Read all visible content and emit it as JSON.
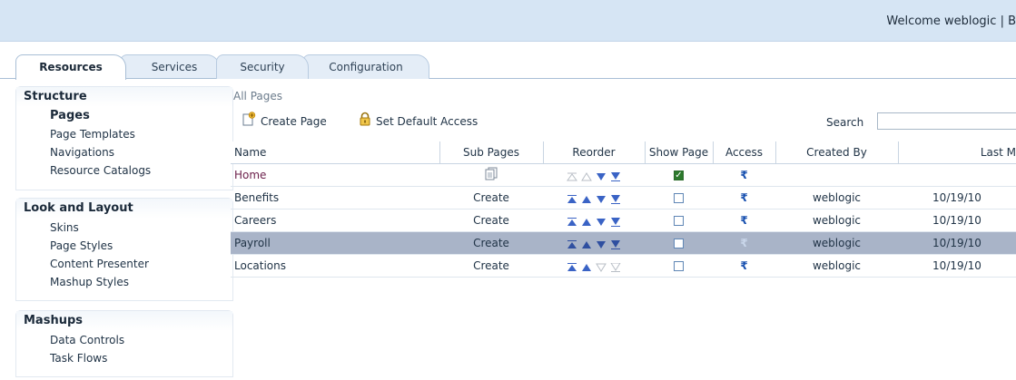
{
  "header": {
    "welcome": "Welcome weblogic  |  B"
  },
  "tabs": [
    {
      "label": "Resources"
    },
    {
      "label": "Services"
    },
    {
      "label": "Security"
    },
    {
      "label": "Configuration"
    }
  ],
  "sidebar": {
    "sections": [
      {
        "title": "Structure",
        "items": [
          {
            "label": "Pages"
          },
          {
            "label": "Page Templates"
          },
          {
            "label": "Navigations"
          },
          {
            "label": "Resource Catalogs"
          }
        ]
      },
      {
        "title": "Look and Layout",
        "items": [
          {
            "label": "Skins"
          },
          {
            "label": "Page Styles"
          },
          {
            "label": "Content Presenter"
          },
          {
            "label": "Mashup Styles"
          }
        ]
      },
      {
        "title": "Mashups",
        "items": [
          {
            "label": "Data Controls"
          },
          {
            "label": "Task Flows"
          }
        ]
      }
    ]
  },
  "main": {
    "breadcrumb": "All Pages",
    "toolbar": {
      "create_page": "Create Page",
      "set_default_access": "Set Default Access"
    },
    "search": {
      "label": "Search",
      "value": ""
    },
    "table": {
      "columns": [
        "Name",
        "Sub Pages",
        "Reorder",
        "Show Page",
        "Access",
        "Created By",
        "Last M"
      ],
      "rows": [
        {
          "name": "Home",
          "sub_pages": "",
          "show_page": true,
          "access": "₹",
          "created_by": "",
          "last_modified": ""
        },
        {
          "name": "Benefits",
          "sub_pages": "Create",
          "show_page": false,
          "access": "₹",
          "created_by": "weblogic",
          "last_modified": "10/19/10"
        },
        {
          "name": "Careers",
          "sub_pages": "Create",
          "show_page": false,
          "access": "₹",
          "created_by": "weblogic",
          "last_modified": "10/19/10"
        },
        {
          "name": "Payroll",
          "sub_pages": "Create",
          "show_page": false,
          "access": "₹",
          "created_by": "weblogic",
          "last_modified": "10/19/10"
        },
        {
          "name": "Locations",
          "sub_pages": "Create",
          "show_page": false,
          "access": "₹",
          "created_by": "weblogic",
          "last_modified": "10/19/10"
        }
      ],
      "selected_row": "Payroll"
    }
  }
}
